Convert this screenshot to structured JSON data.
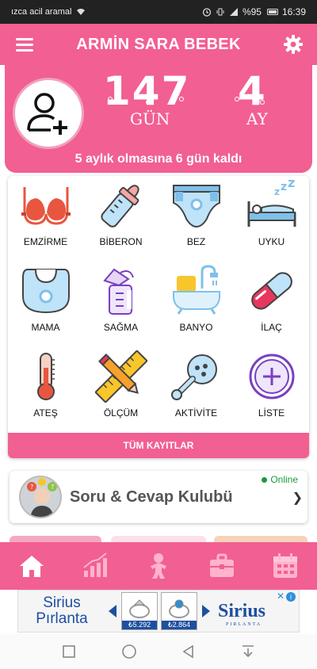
{
  "status_bar": {
    "carrier": "ızca acil aramal",
    "battery": "%95",
    "time": "16:39"
  },
  "header": {
    "title": "ARMİN SARA BEBEK",
    "menu_icon": "hamburger-menu-icon",
    "settings_icon": "gear-icon"
  },
  "hero": {
    "days_value": "147",
    "days_unit": "GÜN",
    "months_value": "4",
    "months_unit": "AY",
    "remaining_text": "5 aylık olmasına 6 gün kaldı",
    "avatar_icon": "add-user-icon"
  },
  "grid": {
    "items": [
      {
        "label": "EMZİRME",
        "icon": "bra-icon"
      },
      {
        "label": "BİBERON",
        "icon": "baby-bottle-icon"
      },
      {
        "label": "BEZ",
        "icon": "diaper-icon"
      },
      {
        "label": "UYKU",
        "icon": "sleep-bed-icon"
      },
      {
        "label": "MAMA",
        "icon": "bib-icon"
      },
      {
        "label": "SAĞMA",
        "icon": "breast-pump-icon"
      },
      {
        "label": "BANYO",
        "icon": "bathtub-icon"
      },
      {
        "label": "İLAÇ",
        "icon": "pill-icon"
      },
      {
        "label": "ATEŞ",
        "icon": "thermometer-icon"
      },
      {
        "label": "ÖLÇÜM",
        "icon": "ruler-pencil-icon"
      },
      {
        "label": "AKTİVİTE",
        "icon": "rattle-icon"
      },
      {
        "label": "LİSTE",
        "icon": "plus-circle-icon"
      }
    ],
    "all_records_label": "TÜM KAYITLAR"
  },
  "club": {
    "title": "Soru & Cevap Kulubü",
    "status": "Online"
  },
  "bottom_nav": [
    "home-icon",
    "chart-icon",
    "baby-icon",
    "toolbox-icon",
    "calendar-icon"
  ],
  "ad": {
    "brand_line1": "Sirius",
    "brand_line2": "Pırlanta",
    "price1": "₺5.292",
    "price2": "₺2.864",
    "logo": "Sirius",
    "logo_sub": "PIRLANTA"
  },
  "colors": {
    "primary": "#f25f92",
    "accent_blue": "#1e4fa0"
  }
}
